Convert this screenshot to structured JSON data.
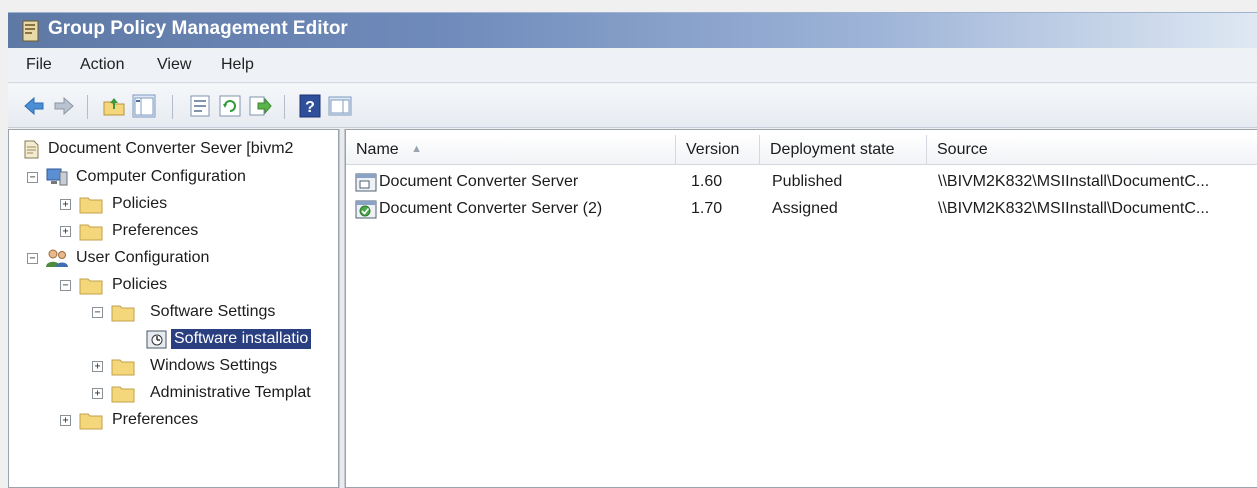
{
  "window": {
    "title": "Group Policy Management Editor"
  },
  "menu": [
    {
      "label": "File"
    },
    {
      "label": "Action"
    },
    {
      "label": "View"
    },
    {
      "label": "Help"
    }
  ],
  "toolbar": {
    "icons": [
      "back-arrow-icon",
      "forward-arrow-icon",
      "up-folder-icon",
      "show-hide-tree-icon",
      "properties-icon",
      "refresh-icon",
      "export-list-icon",
      "help-icon",
      "show-hide-action-pane-icon"
    ]
  },
  "tree": {
    "root": "Document Converter Sever [bivm2",
    "computer_config": "Computer Configuration",
    "cc_policies": "Policies",
    "cc_preferences": "Preferences",
    "user_config": "User Configuration",
    "uc_policies": "Policies",
    "software_settings": "Software Settings",
    "software_installation": "Software installatio",
    "windows_settings": "Windows Settings",
    "admin_templates": "Administrative Templat",
    "uc_preferences": "Preferences"
  },
  "list": {
    "columns": {
      "name": "Name",
      "version": "Version",
      "deployment_state": "Deployment state",
      "source": "Source"
    },
    "rows": [
      {
        "name": "Document Converter Server",
        "version": "1.60",
        "state": "Published",
        "source": "\\\\BIVM2K832\\MSIInstall\\DocumentC..."
      },
      {
        "name": "Document Converter Server (2)",
        "version": "1.70",
        "state": "Assigned",
        "source": "\\\\BIVM2K832\\MSIInstall\\DocumentC..."
      }
    ]
  },
  "colors": {
    "selection": "#2a3f80",
    "titlebar": "#5f79a5",
    "folder": "#f4d77a"
  }
}
